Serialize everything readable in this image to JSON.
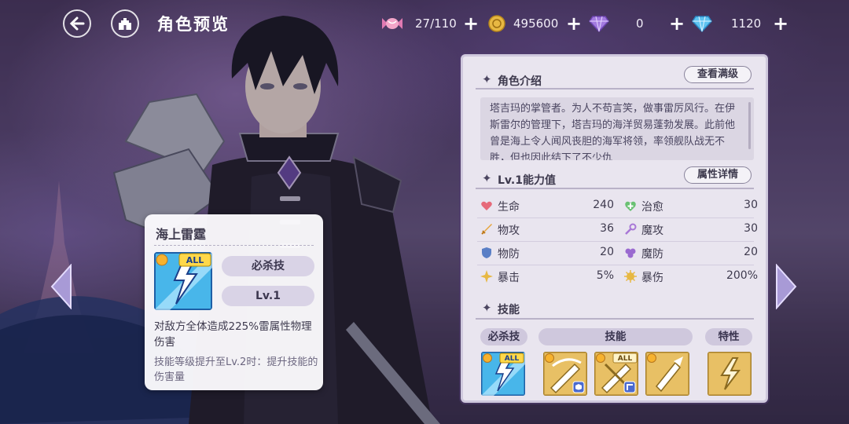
{
  "header": {
    "title": "角色预览"
  },
  "resources": [
    {
      "icon": "candy-icon",
      "value": "27/110"
    },
    {
      "icon": "gold-coin-icon",
      "value": "495600"
    },
    {
      "icon": "purple-gem-icon",
      "value": "0"
    },
    {
      "icon": "blue-diamond-icon",
      "value": "1120"
    }
  ],
  "tooltip": {
    "title": "海上雷霆",
    "type_label": "必杀技",
    "level_label": "Lv.1",
    "icon_badge": "ALL",
    "description": "对敌方全体造成225%雷属性物理伤害",
    "upgrade_text": "技能等级提升至Lv.2时：提升技能的伤害量"
  },
  "panel": {
    "intro": {
      "heading": "角色介绍",
      "button": "查看满级",
      "text": "塔吉玛的掌管者。为人不苟言笑，做事雷厉风行。在伊斯雷尔的管理下，塔吉玛的海洋贸易蓬勃发展。此前他曾是海上令人闻风丧胆的海军将领，率领舰队战无不胜，但也因此结下了不少仇"
    },
    "stats": {
      "heading": "Lv.1能力值",
      "button": "属性详情",
      "rows": [
        {
          "left": {
            "icon": "heart-icon",
            "name": "生命",
            "value": "240"
          },
          "right": {
            "icon": "heal-icon",
            "name": "治愈",
            "value": "30"
          }
        },
        {
          "left": {
            "icon": "sword-icon",
            "name": "物攻",
            "value": "36"
          },
          "right": {
            "icon": "wand-icon",
            "name": "魔攻",
            "value": "30"
          }
        },
        {
          "left": {
            "icon": "shield-icon",
            "name": "物防",
            "value": "20"
          },
          "right": {
            "icon": "magic-shield-icon",
            "name": "魔防",
            "value": "20"
          }
        },
        {
          "left": {
            "icon": "crit-icon",
            "name": "暴击",
            "value": "5%"
          },
          "right": {
            "icon": "crit-damage-icon",
            "name": "暴伤",
            "value": "200%"
          }
        }
      ]
    },
    "skills": {
      "heading": "技能",
      "tabs": [
        "必杀技",
        "技能",
        "特性"
      ],
      "badge_all": "ALL"
    }
  },
  "colors": {
    "accent_purple": "#d9d3e6",
    "panel_bg": "#e9e5ef",
    "gold_icon": "#e7b843",
    "skill_blue": "#2f7fd6"
  }
}
